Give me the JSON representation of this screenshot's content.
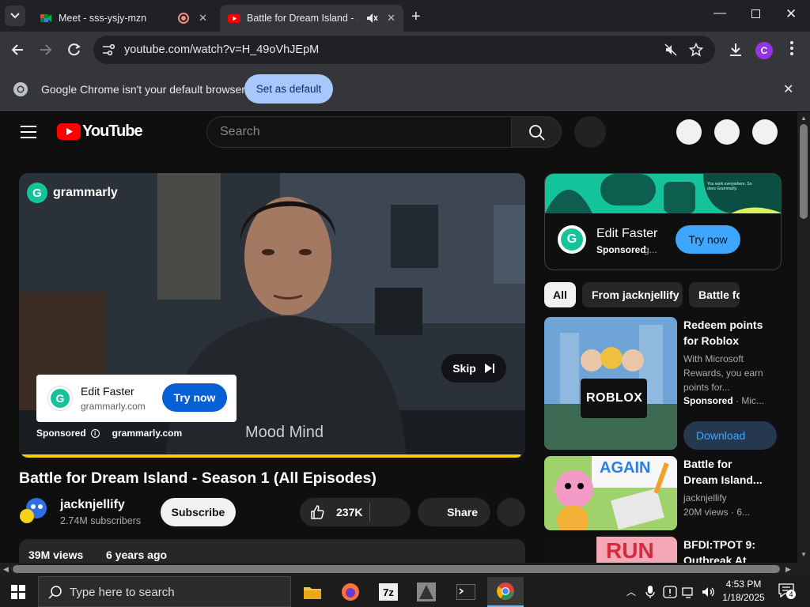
{
  "browser": {
    "tabs": [
      {
        "title": "Meet - sss-ysjy-mzn"
      },
      {
        "title": "Battle for Dream Island - Sea"
      }
    ],
    "url": "youtube.com/watch?v=H_49oVhJEpM",
    "profile_initial": "C",
    "infobar": {
      "message": "Google Chrome isn't your default browser",
      "button": "Set as default"
    }
  },
  "youtube": {
    "logo_text": "YouTube",
    "search_placeholder": "Search",
    "player_ad": {
      "brand": "grammarly",
      "card_title": "Edit Faster",
      "card_url": "grammarly.com",
      "card_button": "Try now",
      "skip": "Skip",
      "sponsored": "Sponsored",
      "sponsored_domain": "grammarly.com",
      "hoodie_text": "Mood Mind",
      "progress": 0.99
    },
    "video": {
      "title": "Battle for Dream Island - Season 1 (All Episodes)",
      "channel": "jacknjellify",
      "subscribers": "2.74M subscribers",
      "subscribe": "Subscribe",
      "likes": "237K",
      "share": "Share",
      "views": "39M views",
      "age": "6 years ago"
    },
    "side_ad": {
      "banner_text": "You work everywhere. So does Grammarly.",
      "title": "Edit Faster",
      "sponsored": "Sponsored",
      "domain": "g...",
      "button": "Try now"
    },
    "chips": [
      "All",
      "From jacknjellify",
      "Battle fo"
    ],
    "recommendations": [
      {
        "title_1": "Redeem points",
        "title_2": "for Roblox",
        "desc_1": "With Microsoft",
        "desc_2": "Rewards, you earn",
        "desc_3": "points for...",
        "sponsored": "Sponsored",
        "advertiser": "Mic...",
        "button": "Download",
        "thumb_text": "ROBLOX"
      },
      {
        "title_1": "Battle for",
        "title_2": "Dream Island...",
        "channel": "jacknjellify",
        "meta": "20M views · 6...",
        "thumb_text": "AGAIN"
      },
      {
        "title_1": "BFDI:TPOT 9:",
        "title_2": "Outbreak At",
        "thumb_text": "RUN"
      }
    ]
  },
  "taskbar": {
    "search_placeholder": "Type here to search",
    "time": "4:53 PM",
    "date": "1/18/2025",
    "notifications": "4"
  }
}
